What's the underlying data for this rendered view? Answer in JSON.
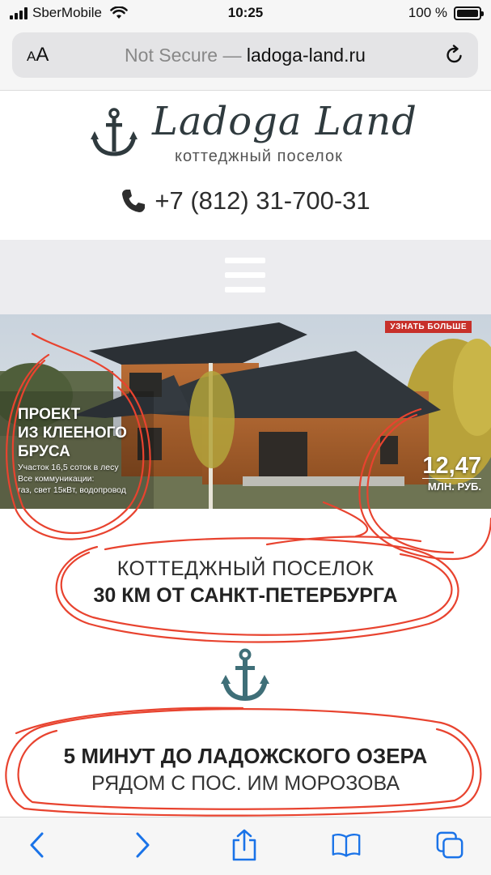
{
  "status_bar": {
    "carrier": "SberMobile",
    "time": "10:25",
    "battery_percent": "100 %",
    "battery_level": 1.0
  },
  "address_bar": {
    "aa_small": "A",
    "aa_large": "A",
    "prefix": "Not Secure — ",
    "domain": "ladoga-land.ru"
  },
  "header": {
    "logo_title": "Ladoga Land",
    "logo_subtitle": "коттеджный поселок",
    "phone": "+7 (812) 31-700-31"
  },
  "banner": {
    "cta": "УЗНАТЬ БОЛЬШЕ",
    "headline": [
      "ПРОЕКТ",
      "ИЗ КЛЕЕНОГО",
      "БРУСА"
    ],
    "details": [
      "Участок 16,5 соток в лесу",
      "Все коммуникации:",
      "газ, свет 15кВт, водопровод"
    ],
    "price": "12,47",
    "price_unit": "МЛН. РУБ."
  },
  "intro": {
    "line1": "КОТТЕДЖНЫЙ ПОСЕЛОК",
    "line2": "30 КМ ОТ САНКТ-ПЕТЕРБУРГА"
  },
  "lake": {
    "line1": "5 МИНУТ ДО ЛАДОЖСКОГО ОЗЕРА",
    "line2": "РЯДОМ С ПОС. ИМ МОРОЗОВА"
  },
  "colors": {
    "accent_teal": "#3f6f78",
    "annotation_red": "#e8432f",
    "ios_blue": "#1a73e8",
    "banner_cta": "#c7302a"
  },
  "icons": {
    "toolbar": [
      "back-icon",
      "forward-icon",
      "share-icon",
      "bookmarks-icon",
      "tabs-icon"
    ]
  }
}
